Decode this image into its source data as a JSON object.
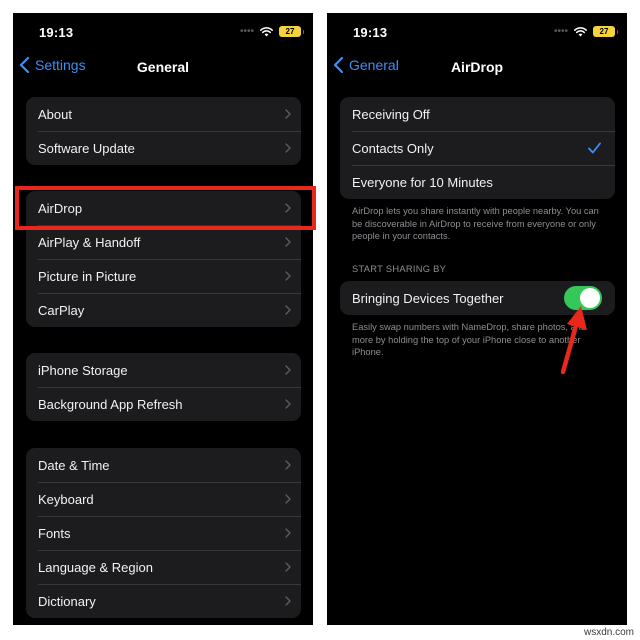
{
  "status_bar": {
    "time": "19:13",
    "battery": "27",
    "signal_dots": "••••"
  },
  "left_screen": {
    "back_label": "Settings",
    "title": "General",
    "groups": [
      {
        "items": [
          "About",
          "Software Update"
        ]
      },
      {
        "items": [
          "AirDrop",
          "AirPlay & Handoff",
          "Picture in Picture",
          "CarPlay"
        ]
      },
      {
        "items": [
          "iPhone Storage",
          "Background App Refresh"
        ]
      },
      {
        "items": [
          "Date & Time",
          "Keyboard",
          "Fonts",
          "Language & Region",
          "Dictionary"
        ]
      }
    ]
  },
  "right_screen": {
    "back_label": "General",
    "title": "AirDrop",
    "receiving_options": [
      "Receiving Off",
      "Contacts Only",
      "Everyone for 10 Minutes"
    ],
    "selected_option": "Contacts Only",
    "receiving_footnote": "AirDrop lets you share instantly with people nearby. You can be discoverable in AirDrop to receive from everyone or only people in your contacts.",
    "section_header": "START SHARING BY",
    "toggle_label": "Bringing Devices Together",
    "toggle_on": true,
    "toggle_footnote": "Easily swap numbers with NameDrop, share photos, and more by holding the top of your iPhone close to another iPhone."
  },
  "colors": {
    "accent_blue": "#3e8ef7",
    "toggle_green": "#34c759",
    "annotation_red": "#e8281c",
    "cell_background": "#1c1c1e",
    "battery_yellow": "#f5d33f"
  },
  "watermark": "wsxdn.com"
}
